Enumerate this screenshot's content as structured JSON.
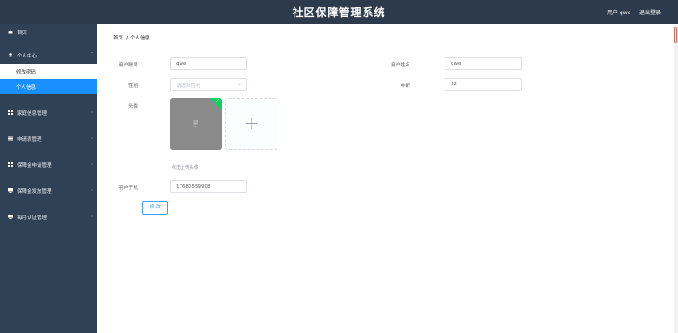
{
  "header": {
    "title": "社区保障管理系统",
    "user_text": "用户 qwe",
    "logout_label": "退出登录"
  },
  "sidebar": {
    "home": "首页",
    "personal_center": "个人中心",
    "change_password": "修改密码",
    "personal_info": "个人信息",
    "household_mgmt": "家庭信息管理",
    "application_mgmt": "申请表管理",
    "guarantee_application_mgmt": "保障金申请管理",
    "guarantee_payment_mgmt": "保障金发放管理",
    "monthly_cert_mgmt": "每月认证管理"
  },
  "breadcrumb": {
    "home": "首页",
    "separator": "/",
    "current": "个人信息"
  },
  "form": {
    "account_label": "用户账号",
    "account_value": "qwe",
    "name_label": "用户姓名",
    "name_value": "qwe",
    "gender_label": "性别",
    "gender_placeholder": "请选择性别",
    "age_label": "年龄",
    "age_value": "12",
    "avatar_label": "头像",
    "upload_hint": "点击上传头像",
    "phone_label": "用户手机",
    "phone_value": "17680559908",
    "submit_label": "修 改"
  },
  "colors": {
    "header_bg": "#2d3a4b",
    "sidebar_bg": "#304156",
    "active_bg": "#1890ff",
    "primary": "#409eff",
    "success": "#13ce66"
  }
}
